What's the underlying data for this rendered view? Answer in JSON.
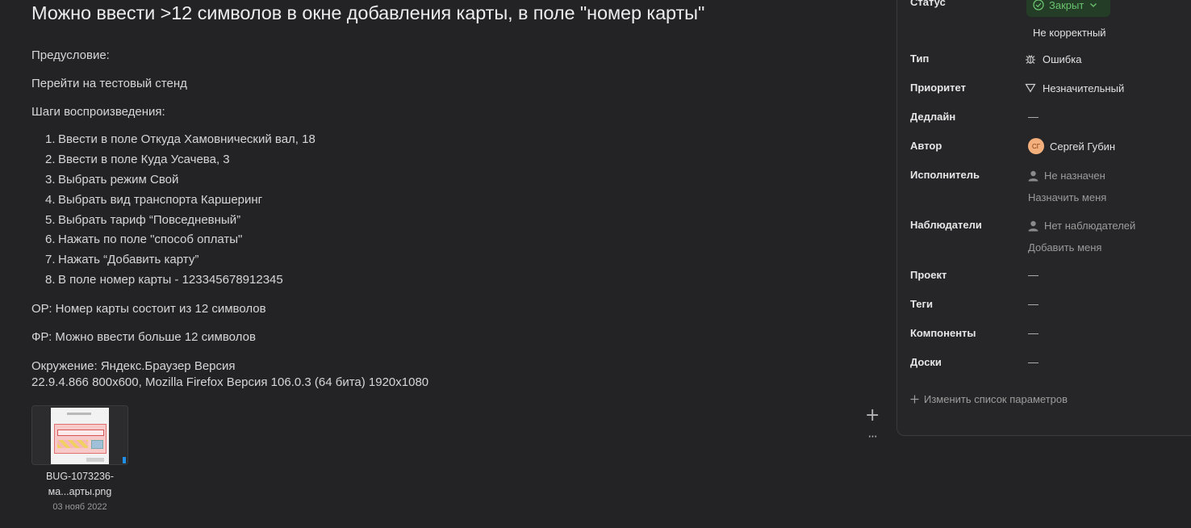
{
  "issue": {
    "title": "Можно ввести >12 символов в окне добавления карты, в поле \"номер карты\"",
    "precondition_label": "Предусловие:",
    "precondition_text": "Перейти на тестовый стенд",
    "steps_label": "Шаги воспроизведения:",
    "steps": [
      {
        "num": "1.",
        "text": "Ввести в поле Откуда Хамовнический вал, 18"
      },
      {
        "num": "2.",
        "text": "Ввести в поле Куда Усачева, 3"
      },
      {
        "num": "3.",
        "text": "Выбрать режим Свой"
      },
      {
        "num": "4.",
        "text": "Выбрать вид транспорта Каршеринг"
      },
      {
        "num": "5.",
        "text": "Выбрать тариф “Повседневный”"
      },
      {
        "num": "6.",
        "text": "Нажать по поле \"способ оплаты\""
      },
      {
        "num": "7.",
        "text": "Нажать “Добавить карту”"
      },
      {
        "num": "8.",
        "text": "В поле номер карты - 123345678912345"
      }
    ],
    "expected": "ОР: Номер карты состоит из 12 символов",
    "actual": "ФР: Можно ввести больше 12 символов",
    "environment_line1": "Окружение: Яндекс.Браузер Версия",
    "environment_line2": "22.9.4.866 800x600, Mozilla Firefox Версия 106.0.3 (64 бита) 1920x1080"
  },
  "attachment": {
    "name_line1": "BUG-1073236-",
    "name_line2": "ма...арты.png",
    "date": "03 нояб 2022"
  },
  "actions": {
    "add_icon": "plus-icon",
    "more_icon": "more-dots-icon"
  },
  "params": {
    "status": {
      "label": "Статус",
      "value": "Закрыт",
      "resolution": "Не корректный"
    },
    "type": {
      "label": "Тип",
      "value": "Ошибка",
      "icon": "bug-icon"
    },
    "priority": {
      "label": "Приоритет",
      "value": "Незначительный",
      "icon": "triangle-down-icon"
    },
    "deadline": {
      "label": "Дедлайн",
      "value": "—"
    },
    "author": {
      "label": "Автор",
      "value": "Сергей Губин",
      "initials": "СГ"
    },
    "assignee": {
      "label": "Исполнитель",
      "value": "Не назначен",
      "action": "Назначить меня"
    },
    "followers": {
      "label": "Наблюдатели",
      "value": "Нет наблюдателей",
      "action": "Добавить меня"
    },
    "project": {
      "label": "Проект",
      "value": "—"
    },
    "tags": {
      "label": "Теги",
      "value": "—"
    },
    "components": {
      "label": "Компоненты",
      "value": "—"
    },
    "boards": {
      "label": "Доски",
      "value": "—"
    },
    "edit_params": "Изменить список параметров"
  },
  "colors": {
    "background": "#232325",
    "status_green": "#6ac26f",
    "avatar": "#f4b07c"
  }
}
